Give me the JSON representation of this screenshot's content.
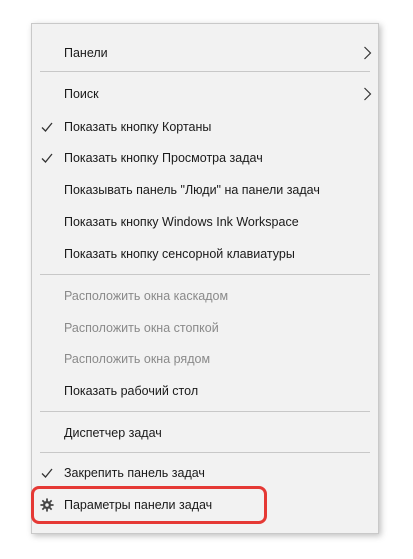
{
  "menu": {
    "items": [
      {
        "label": "Панели",
        "submenu": true
      },
      {
        "label": "Поиск",
        "submenu": true
      },
      {
        "label": "Показать кнопку Кортаны",
        "checked": true
      },
      {
        "label": "Показать кнопку Просмотра задач",
        "checked": true
      },
      {
        "label": "Показывать панель \"Люди\" на панели задач"
      },
      {
        "label": "Показать кнопку Windows Ink Workspace"
      },
      {
        "label": "Показать кнопку сенсорной клавиатуры"
      },
      {
        "label": "Расположить окна каскадом",
        "disabled": true
      },
      {
        "label": "Расположить окна стопкой",
        "disabled": true
      },
      {
        "label": "Расположить окна рядом",
        "disabled": true
      },
      {
        "label": "Показать рабочий стол"
      },
      {
        "label": "Диспетчер задач"
      },
      {
        "label": "Закрепить панель задач",
        "checked": true
      },
      {
        "label": "Параметры панели задач",
        "icon": "gear-icon",
        "highlighted": true
      }
    ]
  },
  "colors": {
    "menu_background": "#f2f2f2",
    "text": "#1a1a1a",
    "disabled_text": "#8a8a8a",
    "highlight_outline": "#e53935"
  }
}
